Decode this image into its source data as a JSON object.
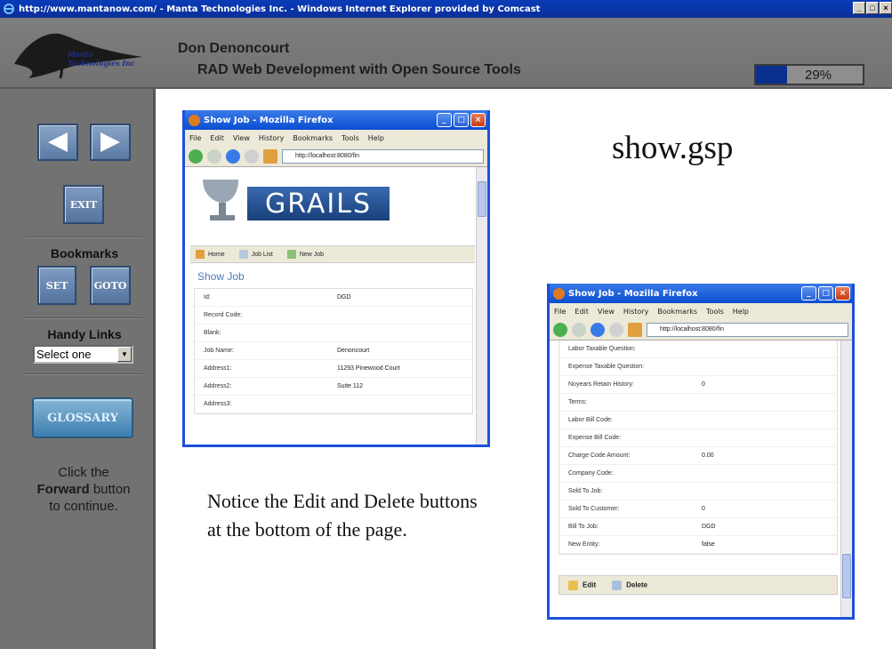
{
  "window": {
    "title": "http://www.mantanow.com/ - Manta Technologies Inc. - Windows Internet Explorer provided by Comcast"
  },
  "header": {
    "logo_text": [
      "Manta",
      "Technologies Inc"
    ],
    "presenter": "Don Denoncourt",
    "course": "RAD Web Development with Open Source Tools",
    "progress_text": "29%",
    "progress_value": 0.29
  },
  "sidebar": {
    "exit_label": "EXIT",
    "bookmarks_label": "Bookmarks",
    "set_label": "SET",
    "goto_label": "GOTO",
    "handy_links_label": "Handy Links",
    "select_value": "Select one",
    "glossary_label": "GLOSSARY",
    "click_text_1": "Click the",
    "click_text_bold": "Forward",
    "click_text_2": " button",
    "click_text_3": "to continue."
  },
  "slide": {
    "title": "show.gsp",
    "notice": "Notice the Edit and Delete buttons at the bottom of the page."
  },
  "ff1": {
    "title": "Show Job - Mozilla Firefox",
    "menu": [
      "File",
      "Edit",
      "View",
      "History",
      "Bookmarks",
      "Tools",
      "Help"
    ],
    "url": "http://localhost:8080/fin",
    "logo_text": "GRAILS",
    "nav": [
      "Home",
      "Job List",
      "New Job"
    ],
    "heading": "Show Job",
    "rows": [
      {
        "k": "Id:",
        "v": "DGD"
      },
      {
        "k": "Record Code:",
        "v": ""
      },
      {
        "k": "Blank:",
        "v": ""
      },
      {
        "k": "Job Name:",
        "v": "Denoncourt"
      },
      {
        "k": "Address1:",
        "v": "11293 Pinewood Court"
      },
      {
        "k": "Address2:",
        "v": "Suite 112"
      },
      {
        "k": "Address3:",
        "v": ""
      }
    ]
  },
  "ff2": {
    "title": "Show Job - Mozilla Firefox",
    "menu": [
      "File",
      "Edit",
      "View",
      "History",
      "Bookmarks",
      "Tools",
      "Help"
    ],
    "url": "http://localhost:8080/fin",
    "rows": [
      {
        "k": "Labor Taxable Question:",
        "v": ""
      },
      {
        "k": "Expense Taxable Question:",
        "v": ""
      },
      {
        "k": "Noyears Retain History:",
        "v": "0"
      },
      {
        "k": "Terms:",
        "v": ""
      },
      {
        "k": "Labor Bill Code:",
        "v": ""
      },
      {
        "k": "Expense Bill Code:",
        "v": ""
      },
      {
        "k": "Charge Code Amount:",
        "v": "0.00"
      },
      {
        "k": "Company Code:",
        "v": ""
      },
      {
        "k": "Sold To Job:",
        "v": ""
      },
      {
        "k": "Sold To Customer:",
        "v": "0"
      },
      {
        "k": "Bill To Job:",
        "v": "DGD"
      },
      {
        "k": "New Entity:",
        "v": "false"
      }
    ],
    "edit_label": "Edit",
    "delete_label": "Delete"
  },
  "colors": {
    "ie_title": "#0a3cb8",
    "frame_gray": "#727272",
    "ff_border": "#1c50d8",
    "progress_fill": "#0b2f8c"
  }
}
